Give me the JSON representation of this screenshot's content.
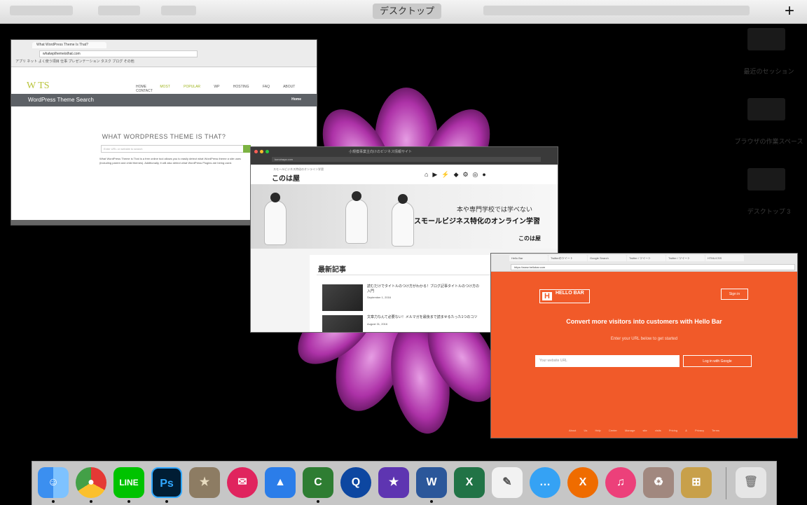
{
  "topbar": {
    "title": "デスクトップ",
    "add_label": "+"
  },
  "window_hellobar": {
    "tabs": [
      "Hello Bar",
      "Twitterのツイート",
      "Google Search",
      "Twitter / ツイート",
      "Twitter / ツイート",
      "HTML/CSS"
    ],
    "url": "https://www.hellobar.com",
    "sign_in": "Sign in",
    "logo_letter": "H",
    "logo_text": "HELLO BAR",
    "headline": "Convert more visitors into customers with Hello Bar",
    "subtitle": "Enter your URL below to get started",
    "input_placeholder": "Your website URL",
    "submit_label": "Log in with Google",
    "footer": "About Us   Help Center   Manage site visits   Pricing & Privacy   Terms"
  },
  "window_wpthemes": {
    "tab": "What WordPress Theme Is That?",
    "url": "whatwpthemeisthat.com",
    "bookmarks": "アプリ  ネット  よく使う項目  仕事  プレゼンテーション  タスク  ブログ  その他",
    "logo": "W TS",
    "menu": [
      "HOME",
      "MOST POPULAR",
      "WP HOSTING",
      "FAQ",
      "ABOUT",
      "CONTACT"
    ],
    "band_title": "WordPress Theme Search",
    "band_link": "Home",
    "heading": "WHAT WORDPRESS THEME IS THAT?",
    "search_placeholder": "Enter URL or website to search",
    "description": "What WordPress Theme is That is a free online tool allows you to easily detect what WordPress theme a site uses (including parent and child themes). Additionally, it will also detect what WordPress Plugins are being used."
  },
  "window_konohaya": {
    "title": "小規模事業主向けのビジネス情報サイト",
    "url": "konohaya.com",
    "slogan": "スモールビジネス特化のオンライン学習",
    "logo": "このは屋",
    "hero_line1": "本や専門学校では学べない",
    "hero_line2": "スモールビジネス特化のオンライン学習",
    "hero_logo": "このは屋",
    "section_title": "最新記事",
    "posts": [
      {
        "title": "読むだけでタイトルのつけ方がわかる！ブログ記事タイトルのつけ方の入門",
        "date": "September 1, 2016"
      },
      {
        "title": "文章力なんて必要ない！メルマガを最後まで読ませるたった1つのコツ",
        "date": "August 31, 2016"
      }
    ]
  },
  "spaces": [
    {
      "label": "最近のセッション"
    },
    {
      "label": "ブラウザの作業スペース"
    },
    {
      "label": "デスクトップ 3"
    }
  ],
  "dock_apps": [
    {
      "name": "Finder",
      "glyph": "☺"
    },
    {
      "name": "Chrome",
      "glyph": "●"
    },
    {
      "name": "LINE",
      "glyph": "LINE"
    },
    {
      "name": "Photoshop",
      "glyph": "Ps"
    },
    {
      "name": "Keychain",
      "glyph": "★"
    },
    {
      "name": "Airmail",
      "glyph": "✉"
    },
    {
      "name": "Keynote",
      "glyph": "▲"
    },
    {
      "name": "Camtasia",
      "glyph": "C"
    },
    {
      "name": "QuickTime",
      "glyph": "Q"
    },
    {
      "name": "iMovie",
      "glyph": "★"
    },
    {
      "name": "Word",
      "glyph": "W"
    },
    {
      "name": "Excel",
      "glyph": "X"
    },
    {
      "name": "Preview",
      "glyph": "✎"
    },
    {
      "name": "Messages",
      "glyph": "…"
    },
    {
      "name": "XMind",
      "glyph": "X"
    },
    {
      "name": "iTunes",
      "glyph": "♫"
    },
    {
      "name": "Archive Utility",
      "glyph": "♻"
    },
    {
      "name": "Applications",
      "glyph": "⊞"
    },
    {
      "name": "Trash",
      "glyph": "🗑"
    }
  ]
}
